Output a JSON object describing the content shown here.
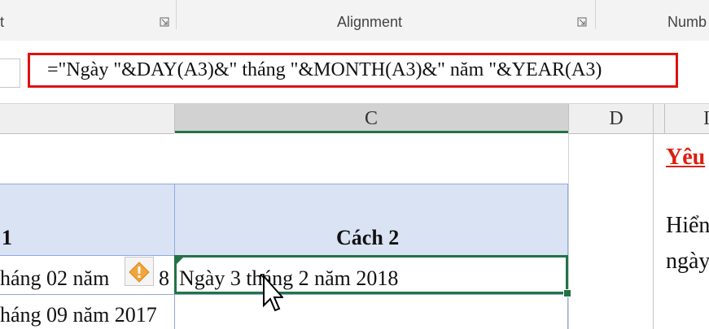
{
  "ribbon": {
    "groups": [
      {
        "label": "t"
      },
      {
        "label": "Alignment"
      },
      {
        "label": "Numb"
      }
    ]
  },
  "formula_bar": {
    "formula": "=\"Ngày \"&DAY(A3)&\" tháng \"&MONTH(A3)&\" năm \"&YEAR(A3)"
  },
  "columns": [
    {
      "label": "C"
    },
    {
      "label": "D"
    },
    {
      "label": "I"
    }
  ],
  "table": {
    "header_left": "1",
    "header_c": "Cách 2",
    "row1_left_a": "háng 02 năm ",
    "row1_left_b": "8",
    "row1_c": "Ngày 3 tháng 2 năm 2018",
    "row2_left": "háng 09 năm 2017"
  },
  "notes": {
    "title": "Yêu",
    "line1": "Hiển",
    "line2": "ngày"
  },
  "colors": {
    "accent_green": "#217346",
    "highlight_red": "#e01010",
    "table_header_blue": "#dae3f3",
    "note_title_red": "#d9200f"
  },
  "icons": [
    "dialog-launcher-icon",
    "warning-icon",
    "move-cursor-icon"
  ]
}
